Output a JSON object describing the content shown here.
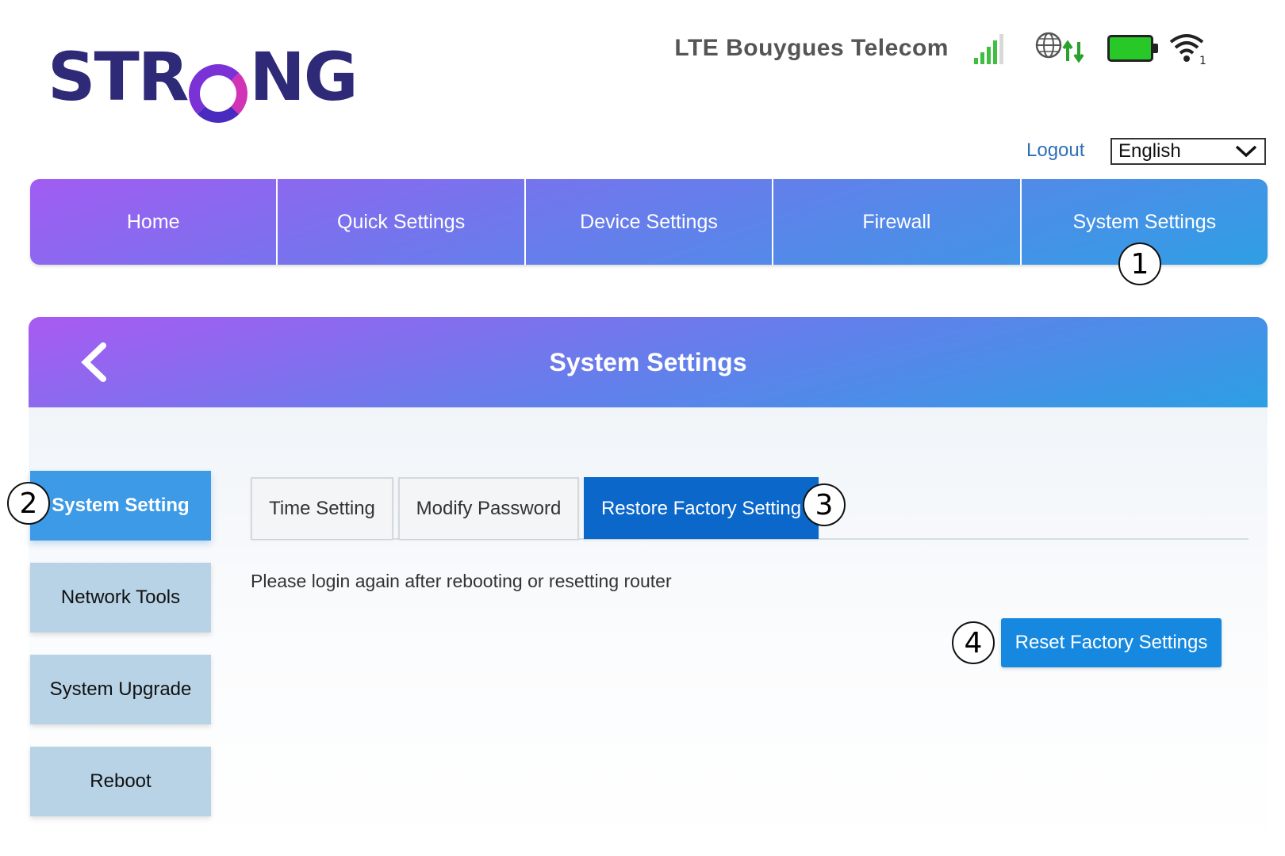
{
  "brand": {
    "logo_before": "STR",
    "logo_after": "NG"
  },
  "status": {
    "network": "LTE  Bouygues Telecom",
    "signal_color": "#3fbf3f",
    "data_arrow_color": "#2aa12a",
    "battery_color": "#28c828",
    "wifi_clients": "1"
  },
  "header": {
    "logout": "Logout",
    "language": "English"
  },
  "nav": {
    "items": [
      "Home",
      "Quick Settings",
      "Device Settings",
      "Firewall",
      "System Settings"
    ]
  },
  "section": {
    "title": "System Settings"
  },
  "sidebar": {
    "items": [
      "System Setting",
      "Network Tools",
      "System Upgrade",
      "Reboot"
    ]
  },
  "tabs": [
    "Time Setting",
    "Modify Password",
    "Restore Factory Setting"
  ],
  "content": {
    "notice": "Please login again after rebooting or resetting router",
    "reset_button": "Reset Factory Settings"
  },
  "callouts": [
    "1",
    "2",
    "3",
    "4"
  ],
  "colors": {
    "accent_blue": "#1688e0",
    "active_tab": "#0b67c9",
    "sidebar_active": "#3d9ae6",
    "sidebar_inactive": "#b8d3e6"
  }
}
